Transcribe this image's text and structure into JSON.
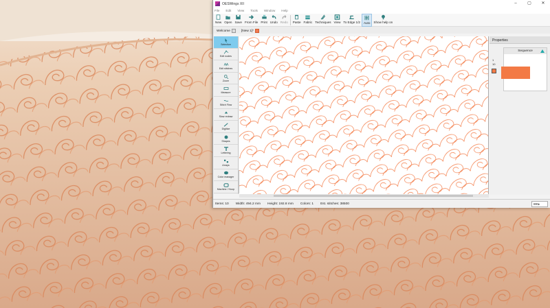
{
  "window": {
    "title": "OESWings XII",
    "controls": [
      "–",
      "▢",
      "✕"
    ]
  },
  "menu": [
    "File",
    "Edit",
    "View",
    "Tools",
    "Window",
    "Help"
  ],
  "toolbar": [
    {
      "label": "New",
      "icon": "new-file-icon"
    },
    {
      "label": "Open",
      "icon": "open-folder-icon"
    },
    {
      "label": "Save",
      "icon": "save-icon"
    },
    {
      "label": "From File",
      "icon": "from-file-icon"
    },
    {
      "label": "Print",
      "icon": "print-icon"
    },
    {
      "label": "Undo",
      "icon": "undo-icon"
    },
    {
      "label": "Redo",
      "icon": "redo-icon",
      "disabled": true
    },
    {
      "label": "Paste",
      "icon": "paste-icon"
    },
    {
      "label": "Fabric",
      "icon": "fabric-icon"
    },
    {
      "label": "Techniques",
      "icon": "techniques-icon"
    },
    {
      "label": "View",
      "icon": "view-icon"
    },
    {
      "label": "To Edge 1/2",
      "icon": "to-edge-icon"
    },
    {
      "label": "Auto",
      "icon": "auto-icon",
      "active": true
    },
    {
      "label": "Show help on",
      "icon": "help-icon"
    }
  ],
  "tabs": [
    {
      "label": "Welcome"
    },
    {
      "label": "[New 1]*"
    }
  ],
  "tools": [
    {
      "label": "Selection",
      "icon": "selection-arrow-icon",
      "active": true
    },
    {
      "label": "Edit nodes",
      "icon": "edit-nodes-icon"
    },
    {
      "label": "Edit stitches",
      "icon": "edit-stitches-icon"
    },
    {
      "label": "Zoom",
      "icon": "zoom-icon"
    },
    {
      "label": "Measure",
      "icon": "measure-icon"
    },
    {
      "label": "Stitch Flow",
      "icon": "stitch-flow-icon"
    },
    {
      "label": "Slow redraw",
      "icon": "slow-redraw-icon"
    },
    {
      "label": "Digitize",
      "icon": "digitize-icon"
    },
    {
      "label": "Shapes",
      "icon": "shapes-icon"
    },
    {
      "label": "Lettering",
      "icon": "lettering-icon"
    },
    {
      "label": "Arrays",
      "icon": "arrays-icon"
    },
    {
      "label": "Color manager",
      "icon": "color-manager-icon"
    },
    {
      "label": "Machine / Hoop",
      "icon": "machine-hoop-icon"
    }
  ],
  "properties": {
    "title": "Properties",
    "sequence_title": "Sequence",
    "numbers": [
      "1",
      "10"
    ]
  },
  "status": {
    "items": "Items: 10",
    "width": "Width: 494.2 mm",
    "height": "Height: 192.8 mm",
    "colors": "Colors: 1",
    "stitches": "Est. stitches: 38500",
    "zoom": "89%"
  },
  "colors": {
    "thread": "#f37a45",
    "selection": "#7ecbee",
    "fabric": "#e9c8ad"
  }
}
